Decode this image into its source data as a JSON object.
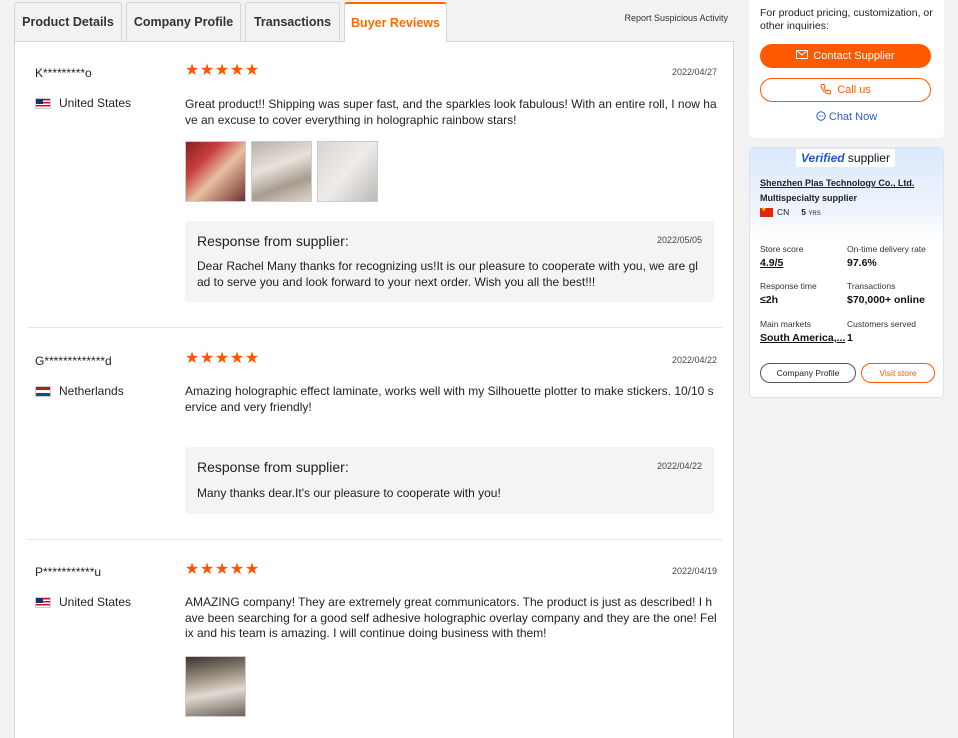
{
  "tabs": [
    {
      "label": "Product Details"
    },
    {
      "label": "Company Profile"
    },
    {
      "label": "Transactions"
    },
    {
      "label": "Buyer Reviews",
      "active": true
    }
  ],
  "report_link": "Report Suspicious Activity",
  "reviews": [
    {
      "reviewer": "K*********o",
      "country": "United States",
      "rating": 5,
      "date": "2022/04/27",
      "text": "Great product!! Shipping was super fast, and the sparkles look fabulous! With an entire roll, I now have an excuse to cover everything in holographic rainbow stars!",
      "images": 3,
      "response": {
        "title": "Response from supplier:",
        "date": "2022/05/05",
        "text": "Dear Rachel Many thanks for recognizing us!It is our pleasure to cooperate with you, we are glad to serve you and look forward to your next order. Wish you all the best!!!"
      }
    },
    {
      "reviewer": "G*************d",
      "country": "Netherlands",
      "rating": 5,
      "date": "2022/04/22",
      "text": "Amazing holographic effect laminate, works well with my Silhouette plotter to make stickers. 10/10 service and very friendly!",
      "images": 0,
      "response": {
        "title": "Response from supplier:",
        "date": "2022/04/22",
        "text": "Many thanks dear.It's our pleasure to cooperate with you!"
      }
    },
    {
      "reviewer": "P***********u",
      "country": "United States",
      "rating": 5,
      "date": "2022/04/19",
      "text": "AMAZING company! They are extremely great communicators. The product is just as described! I have been searching for a good self adhesive holographic overlay company and they are the one! Felix and his team is amazing. I will continue doing business with them!",
      "images": 1
    }
  ],
  "sidebar": {
    "inquiry_text": "For product pricing, customization, or other inquiries:",
    "contact_label": "Contact Supplier",
    "call_label": "Call us",
    "chat_label": "Chat Now",
    "verified_prefix": "Verified",
    "verified_suffix": " supplier",
    "company_name": "Shenzhen Plas Technology Co., Ltd.",
    "supplier_type": "Multispecialty supplier",
    "country_code": "CN",
    "years": "5",
    "years_unit": "YRS",
    "stats": {
      "store_score_label": "Store score",
      "store_score": "4.9/5",
      "on_time_label": "On-time delivery rate",
      "on_time": "97.6%",
      "response_label": "Response time",
      "response": "≤2h",
      "transactions_label": "Transactions",
      "transactions": "$70,000+ online",
      "markets_label": "Main markets",
      "markets": "South America,...",
      "customers_label": "Customers served",
      "customers": "1"
    },
    "profile_btn": "Company Profile",
    "visit_btn": "Visit store"
  },
  "colors": {
    "accent": "#ff6a00",
    "star": "#ff5500",
    "link": "#2a62c8"
  }
}
